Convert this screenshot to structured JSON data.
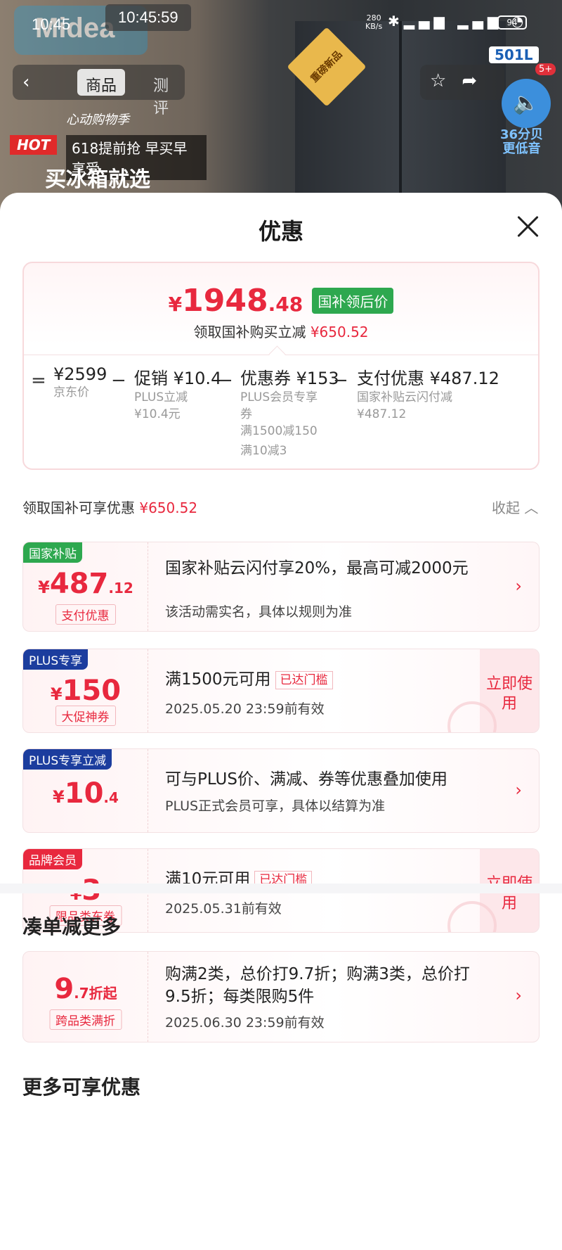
{
  "status_bar": {
    "time": "10:45",
    "time_overlay": "10:45:59",
    "net_speed": "280",
    "net_unit": "KB/s",
    "battery": "94"
  },
  "product_header": {
    "brand": "Midea",
    "tabs": [
      "商品",
      "测评"
    ],
    "promo_slogan": "心动购物季",
    "promo_hot": "HOT",
    "promo_618": "618提前抢 早买早享受",
    "promo_main": "买冰箱就选",
    "new_tag": "重磅新品",
    "size_tag": "501L",
    "notif_badge": "5+",
    "quiet_db": "36分贝",
    "quiet_text": "更低音"
  },
  "sheet": {
    "title": "优惠",
    "final_price": {
      "symbol": "¥",
      "integer": "1948",
      "decimal": ".48",
      "tag": "国补领后价",
      "sub_text": "领取国补购买立减",
      "sub_amount": "¥650.52"
    },
    "breakdown": {
      "equals": "=",
      "minus": "−",
      "items": [
        {
          "title": "¥2599",
          "lines": [
            "京东价"
          ]
        },
        {
          "title": "促销 ¥10.4",
          "lines": [
            "PLUS立减",
            "¥10.4元"
          ]
        },
        {
          "title": "优惠券 ¥153",
          "lines": [
            "PLUS会员专享",
            "券",
            "满1500减150",
            "满10减3"
          ]
        },
        {
          "title": "支付优惠 ¥487.12",
          "lines": [
            "国家补贴云闪付减",
            "¥487.12"
          ]
        }
      ]
    },
    "section_label": "领取国补可享优惠",
    "section_amount": "¥650.52",
    "collapse_label": "收起",
    "coupons": [
      {
        "tag": "国家补贴",
        "symbol": "¥",
        "integer": "487",
        "decimal": ".12",
        "label": "支付优惠",
        "main": "国家补贴云闪付享20%，最高可减2000元",
        "desc": "该活动需实名，具体以规则为准"
      },
      {
        "tag": "PLUS专享",
        "symbol": "¥",
        "integer": "150",
        "decimal": "",
        "label": "大促神券",
        "main": "满1500元可用",
        "reached": "已达门槛",
        "desc": "2025.05.20 23:59前有效",
        "use": "立即使用"
      },
      {
        "tag": "PLUS专享立减",
        "symbol": "¥",
        "integer": "10",
        "decimal": ".4",
        "label": "",
        "main": "可与PLUS价、满减、券等优惠叠加使用",
        "desc": "PLUS正式会员可享，具体以结算为准"
      },
      {
        "tag": "品牌会员",
        "symbol": "¥",
        "integer": "3",
        "decimal": "",
        "label": "限品类东券",
        "main": "满10元可用",
        "reached": "已达门槛",
        "desc": "2025.05.31前有效",
        "use": "立即使用"
      }
    ],
    "more_section": {
      "title": "凑单减更多",
      "card": {
        "integer": "9",
        "decimal": ".7折起",
        "label": "跨品类满折",
        "main": "购满2类，总价打9.7折；购满3类，总价打9.5折；每类限购5件",
        "desc": "2025.06.30 23:59前有效"
      }
    },
    "more_title": "更多可享优惠"
  },
  "colors": {
    "accent_red": "#e8283e",
    "green": "#2ea84f",
    "plus_blue": "#1c3d9e"
  }
}
